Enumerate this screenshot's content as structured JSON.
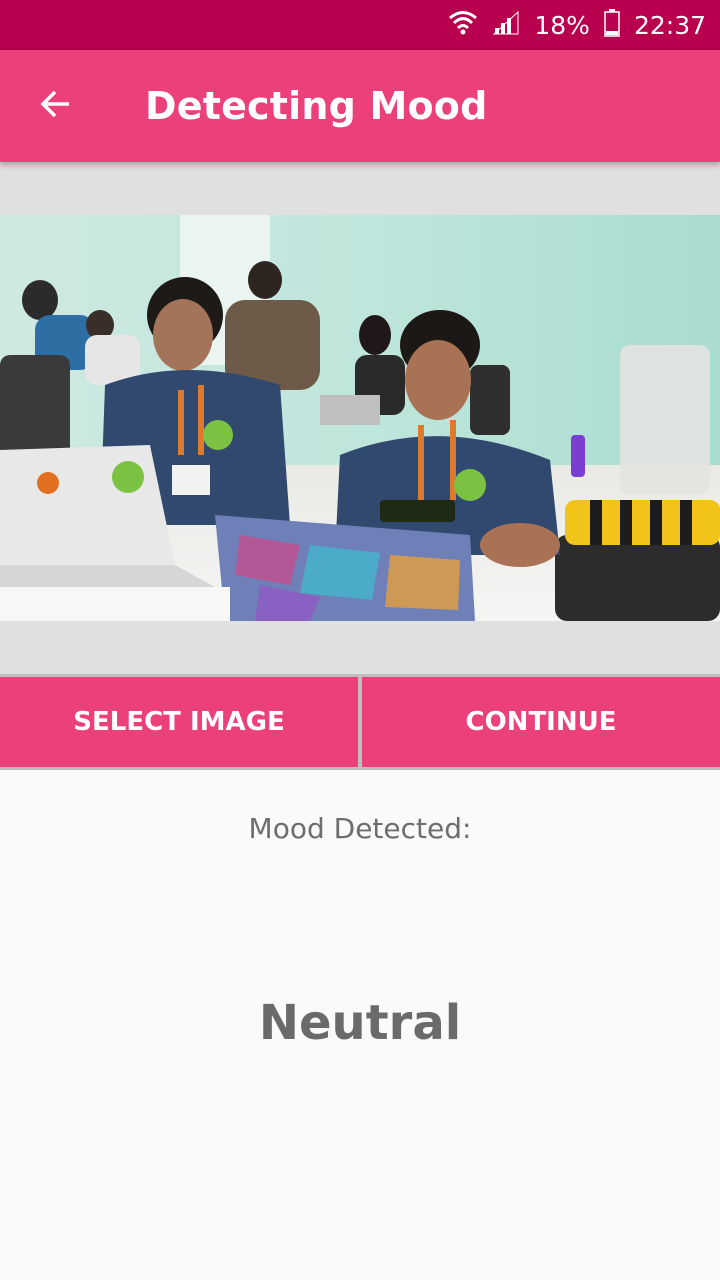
{
  "status_bar": {
    "battery": "18%",
    "time": "22:37",
    "icons": [
      "wifi-icon",
      "signal-icon",
      "battery-icon"
    ]
  },
  "app_bar": {
    "title": "Detecting Mood",
    "back_icon": "arrow-back-icon"
  },
  "image": {
    "alt": "Photo of people working on laptops"
  },
  "buttons": {
    "select_image": "SELECT IMAGE",
    "continue": "CONTINUE"
  },
  "result": {
    "label": "Mood Detected:",
    "value": "Neutral"
  },
  "colors": {
    "status_bar": "#b8004f",
    "app_bar": "#ec407a",
    "button": "#ec407a",
    "background": "#fafafa",
    "panel": "#e0e0e0",
    "text_muted": "#6e6e6e"
  }
}
